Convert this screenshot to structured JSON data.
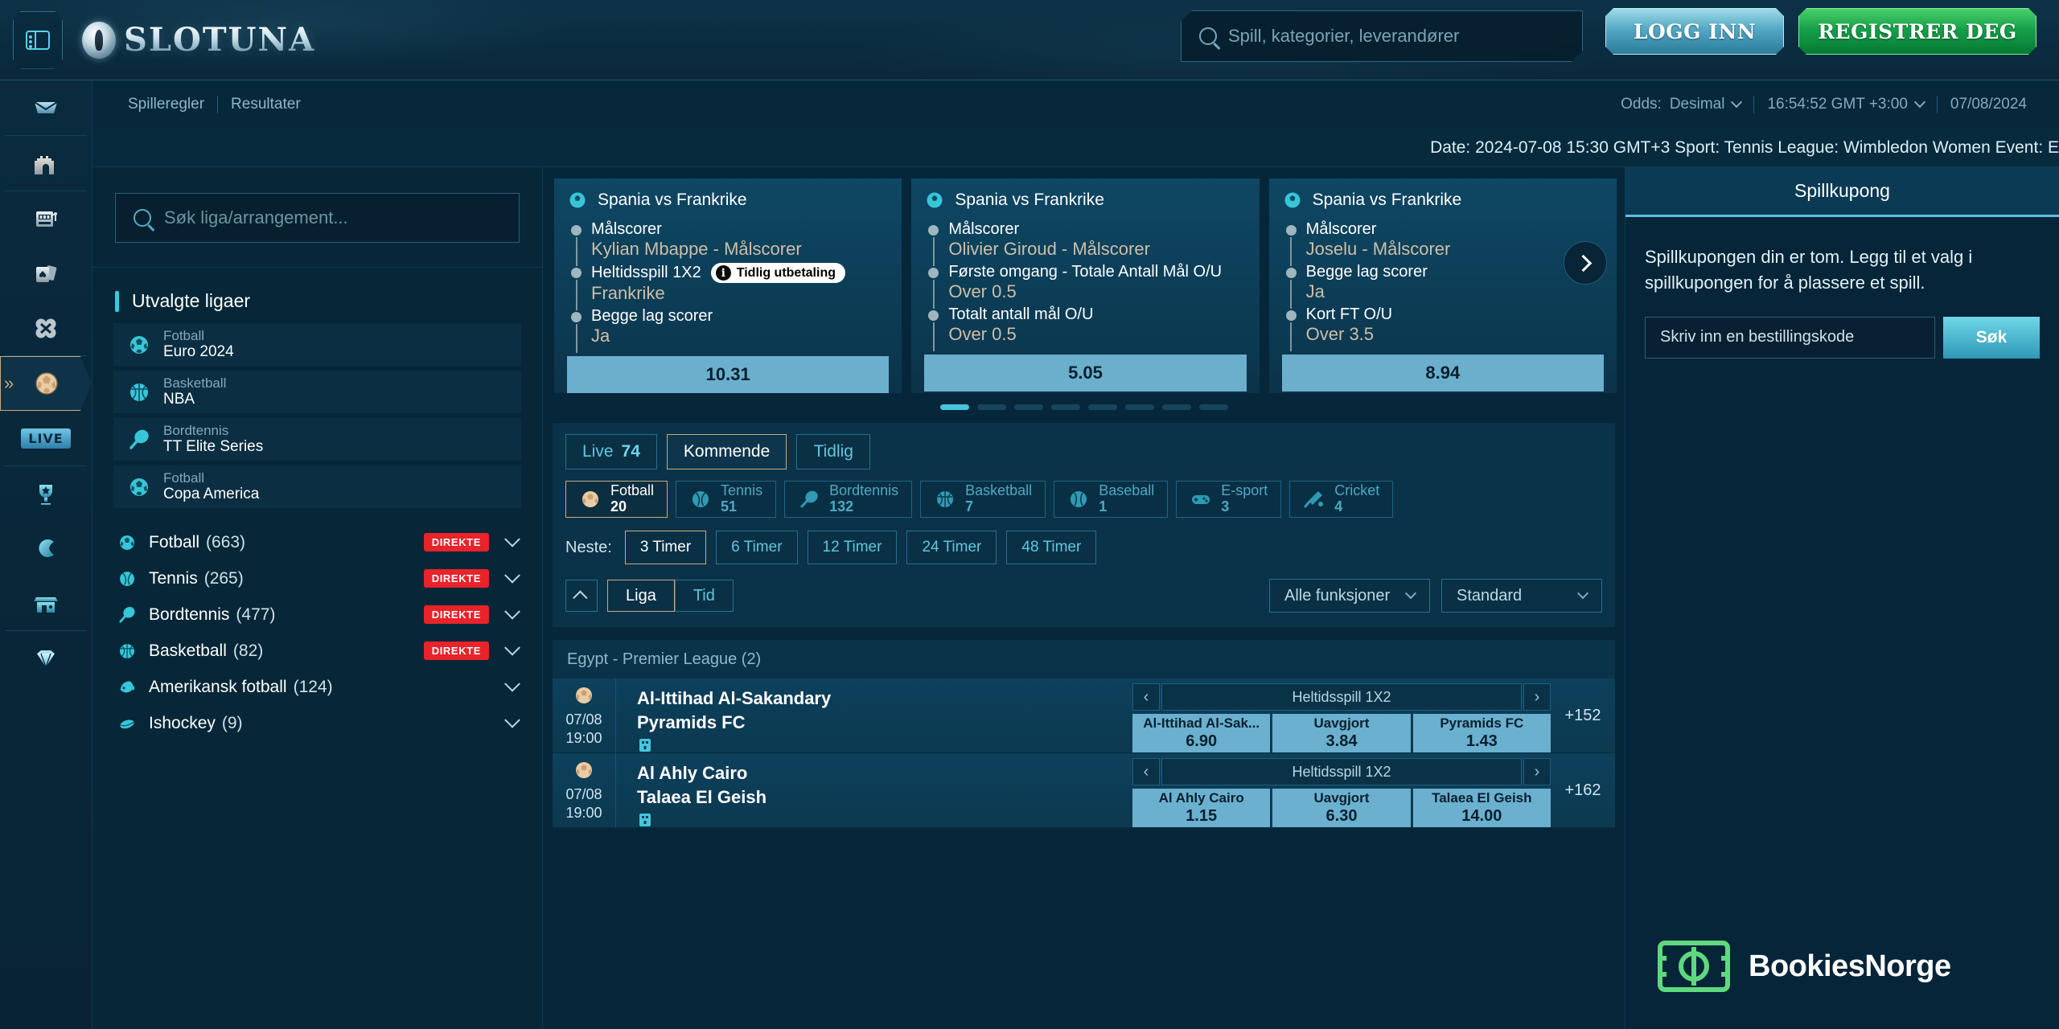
{
  "header": {
    "brand": "SLOTUNA",
    "menu_icon": "menu-icon",
    "search_placeholder": "Spill, kategorier, leverandører",
    "login_label": "LOGG INN",
    "register_label": "REGISTRER DEG"
  },
  "rail": {
    "items": [
      {
        "icon": "casino-banner-icon",
        "label": "",
        "active": false
      },
      {
        "icon": "castle-icon",
        "label": "",
        "active": false
      },
      {
        "icon": "slot-machine-icon",
        "label": "",
        "active": false
      },
      {
        "icon": "cards-icon",
        "label": "",
        "active": false
      },
      {
        "icon": "clover-icon",
        "label": "",
        "active": false
      },
      {
        "icon": "football-icon",
        "label": "",
        "active": true
      },
      {
        "icon": "live-badge-icon",
        "label": "LIVE",
        "active": false
      },
      {
        "icon": "trophy-icon",
        "label": "",
        "active": false
      },
      {
        "icon": "crescent-icon",
        "label": "",
        "active": false
      },
      {
        "icon": "shop-icon",
        "label": "",
        "active": false
      },
      {
        "icon": "diamond-icon",
        "label": "",
        "active": false
      }
    ]
  },
  "subnav": {
    "links": [
      "Spilleregler",
      "Resultater"
    ],
    "odds_label": "Odds:",
    "odds_value": "Desimal",
    "time_value": "16:54:52 GMT +3:00",
    "date_value": "07/08/2024"
  },
  "ticker": {
    "text": "Date: 2024-07-08 15:30 GMT+3 Sport: Tennis League: Wimbledon Women Event: E"
  },
  "left_panel": {
    "search_placeholder": "Søk liga/arrangement...",
    "featured_title": "Utvalgte ligaer",
    "featured": [
      {
        "sport": "Fotball",
        "name": "Euro 2024",
        "icon": "football-icon"
      },
      {
        "sport": "Basketball",
        "name": "NBA",
        "icon": "basketball-icon"
      },
      {
        "sport": "Bordtennis",
        "name": "TT Elite Series",
        "icon": "table-tennis-icon"
      },
      {
        "sport": "Fotball",
        "name": "Copa America",
        "icon": "football-icon"
      }
    ],
    "sports": [
      {
        "name": "Fotball",
        "count": "(663)",
        "live": "DIREKTE",
        "icon": "football-icon"
      },
      {
        "name": "Tennis",
        "count": "(265)",
        "live": "DIREKTE",
        "icon": "tennis-icon"
      },
      {
        "name": "Bordtennis",
        "count": "(477)",
        "live": "DIREKTE",
        "icon": "table-tennis-icon"
      },
      {
        "name": "Basketball",
        "count": "(82)",
        "live": "DIREKTE",
        "icon": "basketball-icon"
      },
      {
        "name": "Amerikansk fotball",
        "count": "(124)",
        "live": "",
        "icon": "american-football-icon"
      },
      {
        "name": "Ishockey",
        "count": "(9)",
        "live": "",
        "icon": "ice-hockey-icon"
      }
    ]
  },
  "carousel": {
    "cards": [
      {
        "title": "Spania vs Frankrike",
        "legs": [
          {
            "market": "Målscorer",
            "pick": "Kylian Mbappe - Målscorer",
            "tag": ""
          },
          {
            "market": "Heltidsspill 1X2",
            "pick": "Frankrike",
            "tag": "Tidlig utbetaling"
          },
          {
            "market": "Begge lag scorer",
            "pick": "Ja",
            "tag": ""
          }
        ],
        "odds": "10.31"
      },
      {
        "title": "Spania vs Frankrike",
        "legs": [
          {
            "market": "Målscorer",
            "pick": "Olivier Giroud - Målscorer",
            "tag": ""
          },
          {
            "market": "Første omgang - Totale Antall Mål O/U",
            "pick": "Over 0.5",
            "tag": ""
          },
          {
            "market": "Totalt antall mål O/U",
            "pick": "Over 0.5",
            "tag": ""
          }
        ],
        "odds": "5.05"
      },
      {
        "title": "Spania vs Frankrike",
        "legs": [
          {
            "market": "Målscorer",
            "pick": "Joselu - Målscorer",
            "tag": ""
          },
          {
            "market": "Begge lag scorer",
            "pick": "Ja",
            "tag": ""
          },
          {
            "market": "Kort FT O/U",
            "pick": "Over 3.5",
            "tag": ""
          }
        ],
        "odds": "8.94"
      }
    ],
    "dot_count": 8,
    "active_dot": 0
  },
  "filters": {
    "tabs": [
      {
        "label": "Live",
        "count": "74",
        "selected": false
      },
      {
        "label": "Kommende",
        "count": "",
        "selected": true
      },
      {
        "label": "Tidlig",
        "count": "",
        "selected": false
      }
    ],
    "sport_chips": [
      {
        "name": "Fotball",
        "count": "20",
        "icon": "football-icon",
        "selected": true
      },
      {
        "name": "Tennis",
        "count": "51",
        "icon": "tennis-icon",
        "selected": false
      },
      {
        "name": "Bordtennis",
        "count": "132",
        "icon": "table-tennis-icon",
        "selected": false
      },
      {
        "name": "Basketball",
        "count": "7",
        "icon": "basketball-icon",
        "selected": false
      },
      {
        "name": "Baseball",
        "count": "1",
        "icon": "baseball-icon",
        "selected": false
      },
      {
        "name": "E-sport",
        "count": "3",
        "icon": "gamepad-icon",
        "selected": false
      },
      {
        "name": "Cricket",
        "count": "4",
        "icon": "cricket-icon",
        "selected": false
      }
    ],
    "next_label": "Neste:",
    "time_buttons": [
      {
        "label": "3 Timer",
        "selected": true
      },
      {
        "label": "6 Timer",
        "selected": false
      },
      {
        "label": "12 Timer",
        "selected": false
      },
      {
        "label": "24 Timer",
        "selected": false
      },
      {
        "label": "48 Timer",
        "selected": false
      }
    ],
    "sort_segments": [
      {
        "label": "Liga",
        "selected": true
      },
      {
        "label": "Tid",
        "selected": false
      }
    ],
    "dropdowns": [
      {
        "label": "Alle funksjoner"
      },
      {
        "label": "Standard"
      }
    ]
  },
  "matches": {
    "league_header": "Egypt - Premier League (2)",
    "rows": [
      {
        "date": "07/08",
        "time": "19:00",
        "home": "Al-Ittihad Al-Sakandary",
        "away": "Pyramids FC",
        "market": "Heltidsspill 1X2",
        "odds": [
          {
            "label": "Al-Ittihad Al-Sak...",
            "value": "6.90"
          },
          {
            "label": "Uavgjort",
            "value": "3.84"
          },
          {
            "label": "Pyramids FC",
            "value": "1.43"
          }
        ],
        "more": "+152"
      },
      {
        "date": "07/08",
        "time": "19:00",
        "home": "Al Ahly Cairo",
        "away": "Talaea El Geish",
        "market": "Heltidsspill 1X2",
        "odds": [
          {
            "label": "Al Ahly Cairo",
            "value": "1.15"
          },
          {
            "label": "Uavgjort",
            "value": "6.30"
          },
          {
            "label": "Talaea El Geish",
            "value": "14.00"
          }
        ],
        "more": "+162"
      }
    ]
  },
  "betslip": {
    "title": "Spillkupong",
    "empty_message": "Spillkupongen din er tom. Legg til et valg i spillkupongen for å plassere et spill.",
    "code_placeholder": "Skriv inn en bestillingskode",
    "search_label": "Søk"
  },
  "watermark": {
    "text": "BookiesNorge",
    "icon": "pitch-note-icon",
    "color": "#5fd97f"
  }
}
